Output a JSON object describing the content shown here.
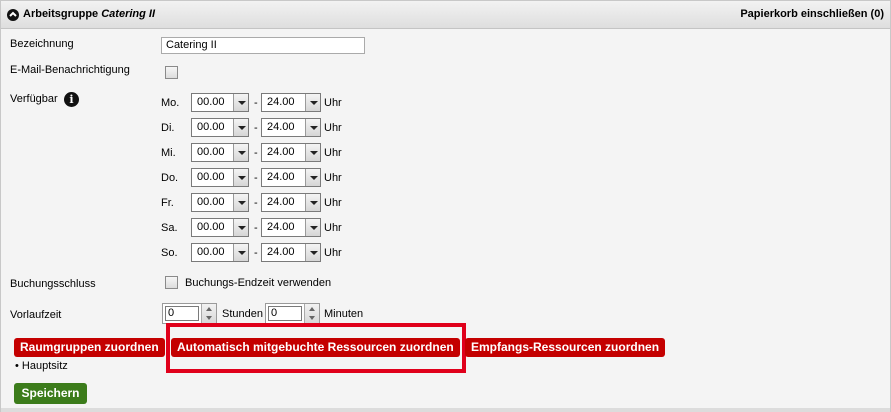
{
  "header": {
    "title_prefix": "Arbeitsgruppe ",
    "title_name": "Catering II",
    "trash_label": "Papierkorb einschließen (0)"
  },
  "form": {
    "name_label": "Bezeichnung",
    "name_value": "Catering II",
    "email_label": "E-Mail-Benachrichtigung",
    "available_label": "Verfügbar",
    "info_icon": "i",
    "days": [
      {
        "day": "Mo.",
        "from": "00.00",
        "to": "24.00",
        "unit": "Uhr"
      },
      {
        "day": "Di.",
        "from": "00.00",
        "to": "24.00",
        "unit": "Uhr"
      },
      {
        "day": "Mi.",
        "from": "00.00",
        "to": "24.00",
        "unit": "Uhr"
      },
      {
        "day": "Do.",
        "from": "00.00",
        "to": "24.00",
        "unit": "Uhr"
      },
      {
        "day": "Fr.",
        "from": "00.00",
        "to": "24.00",
        "unit": "Uhr"
      },
      {
        "day": "Sa.",
        "from": "00.00",
        "to": "24.00",
        "unit": "Uhr"
      },
      {
        "day": "So.",
        "from": "00.00",
        "to": "24.00",
        "unit": "Uhr"
      }
    ],
    "dash": "-",
    "booking_label": "Buchungsschluss",
    "booking_checkbox_label": "Buchungs-Endzeit verwenden",
    "lead_label": "Vorlaufzeit",
    "hours_value": "0",
    "hours_unit": "Stunden",
    "minutes_value": "0",
    "minutes_unit": "Minuten"
  },
  "actions": {
    "room_groups": "Raumgruppen zuordnen",
    "auto_resources": "Automatisch mitgebuchte Ressourcen zuordnen",
    "reception_resources": "Empfangs-Ressourcen zuordnen",
    "bullet_item": "• Hauptsitz",
    "save": "Speichern"
  },
  "colors": {
    "action_red": "#c40000",
    "save_green": "#3c7c1b",
    "highlight": "#e0001b"
  }
}
